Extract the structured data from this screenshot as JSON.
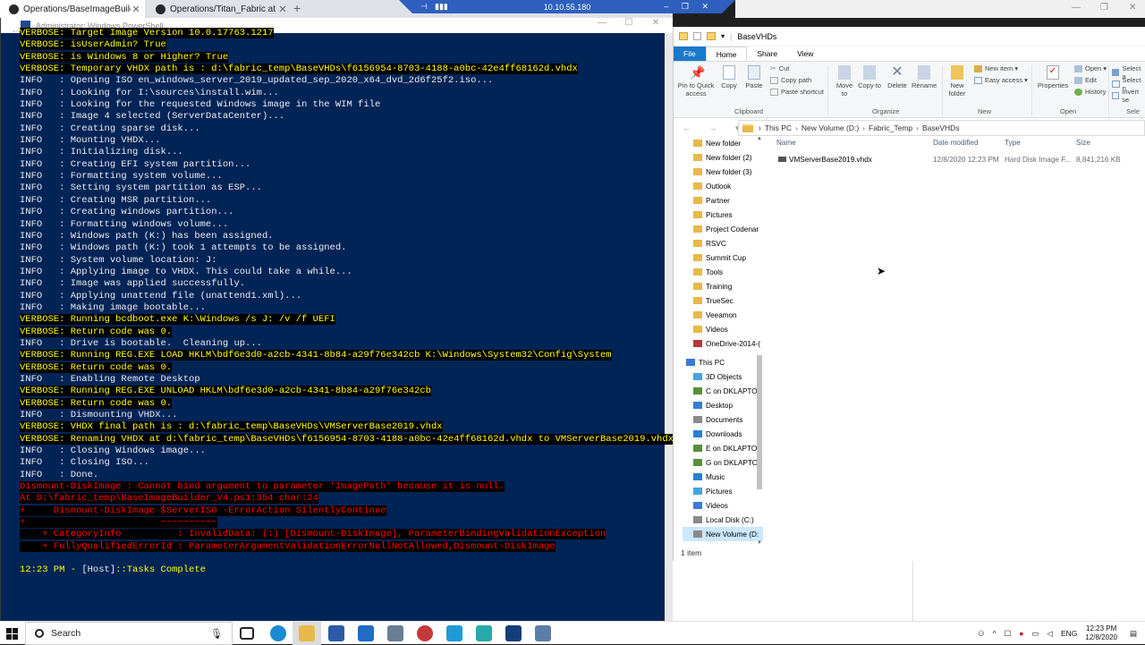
{
  "browser": {
    "tabs": [
      {
        "label": "Operations/BaseImageBuilder_V"
      },
      {
        "label": "Operations/Titan_Fabric at mast"
      }
    ],
    "new_tab": "+"
  },
  "rdp": {
    "address": "10.10.55.180",
    "pin": "⊣",
    "signal": "▮▮▮",
    "controls": "–  ❐  ✕"
  },
  "powershell": {
    "title": "Administrator: Windows PowerShell",
    "back": "←",
    "lines": [
      {
        "type": "verbose",
        "text": "VERBOSE: Target Image Version 10.0.17763.1217"
      },
      {
        "type": "verbose",
        "text": "VERBOSE: isUserAdmin? True"
      },
      {
        "type": "verbose",
        "text": "VERBOSE: is Windows 8 or Higher? True"
      },
      {
        "type": "verbose",
        "text": "VERBOSE: Temporary VHDX path is : d:\\fabric_temp\\BaseVHDs\\f6156954-8703-4188-a0bc-42e4ff68162d.vhdx"
      },
      {
        "type": "info",
        "text": "INFO   : Opening ISO en_windows_server_2019_updated_sep_2020_x64_dvd_2d6f25f2.iso..."
      },
      {
        "type": "info",
        "text": "INFO   : Looking for I:\\sources\\install.wim..."
      },
      {
        "type": "info",
        "text": "INFO   : Looking for the requested Windows image in the WIM file"
      },
      {
        "type": "info",
        "text": "INFO   : Image 4 selected (ServerDataCenter)..."
      },
      {
        "type": "info",
        "text": "INFO   : Creating sparse disk..."
      },
      {
        "type": "info",
        "text": "INFO   : Mounting VHDX..."
      },
      {
        "type": "info",
        "text": "INFO   : Initializing disk..."
      },
      {
        "type": "info",
        "text": "INFO   : Creating EFI system partition..."
      },
      {
        "type": "info",
        "text": "INFO   : Formatting system volume..."
      },
      {
        "type": "info",
        "text": "INFO   : Setting system partition as ESP..."
      },
      {
        "type": "info",
        "text": "INFO   : Creating MSR partition..."
      },
      {
        "type": "info",
        "text": "INFO   : Creating windows partition..."
      },
      {
        "type": "info",
        "text": "INFO   : Formatting windows volume..."
      },
      {
        "type": "info",
        "text": "INFO   : Windows path (K:) has been assigned."
      },
      {
        "type": "info",
        "text": "INFO   : Windows path (K:) took 1 attempts to be assigned."
      },
      {
        "type": "info",
        "text": "INFO   : System volume location: J:"
      },
      {
        "type": "info",
        "text": "INFO   : Applying image to VHDX. This could take a while..."
      },
      {
        "type": "info",
        "text": "INFO   : Image was applied successfully."
      },
      {
        "type": "info",
        "text": "INFO   : Applying unattend file (unattend1.xml)..."
      },
      {
        "type": "info",
        "text": "INFO   : Making image bootable..."
      },
      {
        "type": "verbose",
        "text": "VERBOSE: Running bcdboot.exe K:\\Windows /s J: /v /f UEFI"
      },
      {
        "type": "verbose",
        "text": "VERBOSE: Return code was 0."
      },
      {
        "type": "info",
        "text": "INFO   : Drive is bootable.  Cleaning up..."
      },
      {
        "type": "verbose",
        "text": "VERBOSE: Running REG.EXE LOAD HKLM\\bdf6e3d0-a2cb-4341-8b84-a29f76e342cb K:\\Windows\\System32\\Config\\System"
      },
      {
        "type": "verbose",
        "text": "VERBOSE: Return code was 0."
      },
      {
        "type": "info",
        "text": "INFO   : Enabling Remote Desktop"
      },
      {
        "type": "verbose",
        "text": "VERBOSE: Running REG.EXE UNLOAD HKLM\\bdf6e3d0-a2cb-4341-8b84-a29f76e342cb"
      },
      {
        "type": "verbose",
        "text": "VERBOSE: Return code was 0."
      },
      {
        "type": "info",
        "text": "INFO   : Dismounting VHDX..."
      },
      {
        "type": "verbose",
        "text": "VERBOSE: VHDX final path is : d:\\fabric_temp\\BaseVHDs\\VMServerBase2019.vhdx"
      },
      {
        "type": "verbose",
        "text": "VERBOSE: Renaming VHDX at d:\\fabric_temp\\BaseVHDs\\f6156954-8703-4188-a0bc-42e4ff68162d.vhdx to VMServerBase2019.vhdx"
      },
      {
        "type": "info",
        "text": "INFO   : Closing Windows image..."
      },
      {
        "type": "info",
        "text": "INFO   : Closing ISO..."
      },
      {
        "type": "info",
        "text": "INFO   : Done."
      },
      {
        "type": "err",
        "text": "Dismount-DiskImage : Cannot bind argument to parameter 'ImagePath' because it is null."
      },
      {
        "type": "err",
        "text": "At D:\\fabric_temp\\BaseImageBuilder_V4.ps1:354 char:24"
      },
      {
        "type": "err",
        "text": "+     Dismount-DiskImage $ServerISO -ErrorAction SilentlyContinue"
      },
      {
        "type": "err",
        "text": "+                        ~~~~~~~~~~"
      },
      {
        "type": "err",
        "text": "    + CategoryInfo          : InvalidData: (:) [Dismount-DiskImage], ParameterBindingValidationException"
      },
      {
        "type": "err",
        "text": "    + FullyQualifiedErrorId : ParameterArgumentValidationErrorNullNotAllowed,Dismount-DiskImage"
      },
      {
        "type": "blank",
        "text": ""
      }
    ],
    "prompt": {
      "time": "12:23 PM - ",
      "host": "[Host]",
      "rest": "::Tasks Complete"
    }
  },
  "explorer": {
    "title": "BaseVHDs",
    "tabs": [
      "File",
      "Home",
      "Share",
      "View"
    ],
    "ribbon": {
      "pin_label": "Pin to Quick access",
      "copy": "Copy",
      "paste": "Paste",
      "cut": "Cut",
      "copy_path": "Copy path",
      "paste_shortcut": "Paste shortcut",
      "clipboard": "Clipboard",
      "move_to": "Move to",
      "copy_to": "Copy to",
      "delete": "Delete",
      "rename": "Rename",
      "organize": "Organize",
      "new_folder": "New folder",
      "new_item": "New item ▾",
      "easy_access": "Easy access ▾",
      "new_group": "New",
      "properties": "Properties",
      "open": "Open ▾",
      "edit": "Edit",
      "history": "History",
      "open_group": "Open",
      "select_all": "Select a",
      "select_none": "Select n",
      "invert": "Invert se",
      "select_group": "Sele"
    },
    "nav_buttons": "← → ▾ ↑",
    "breadcrumb": [
      "This PC",
      "New Volume (D:)",
      "Fabric_Temp",
      "BaseVHDs"
    ],
    "nav_items": [
      {
        "label": "New folder",
        "color": "#e8b84a"
      },
      {
        "label": "New folder (2)",
        "color": "#e8b84a"
      },
      {
        "label": "New folder (3)",
        "color": "#e8b84a"
      },
      {
        "label": "Outlook",
        "color": "#e8b84a"
      },
      {
        "label": "Partner",
        "color": "#e8b84a"
      },
      {
        "label": "Pictures",
        "color": "#e8b84a"
      },
      {
        "label": "Project Codenar",
        "color": "#e8b84a"
      },
      {
        "label": "RSVC",
        "color": "#e8b84a"
      },
      {
        "label": "Summit Cup",
        "color": "#e8b84a"
      },
      {
        "label": "Tools",
        "color": "#e8b84a"
      },
      {
        "label": "Training",
        "color": "#e8b84a"
      },
      {
        "label": "TrueSec",
        "color": "#e8b84a"
      },
      {
        "label": "Veeamon",
        "color": "#e8b84a"
      },
      {
        "label": "Videos",
        "color": "#e8b84a"
      },
      {
        "label": "OneDrive-2014-(",
        "color": "#b33a3a"
      }
    ],
    "this_pc_items": [
      {
        "label": "This PC",
        "color": "#3b7bd4"
      },
      {
        "label": "3D Objects",
        "color": "#4aa3df"
      },
      {
        "label": "C on DKLAPTOP",
        "color": "#5a8f3c"
      },
      {
        "label": "Desktop",
        "color": "#3b7bd4"
      },
      {
        "label": "Documents",
        "color": "#8a8a8a"
      },
      {
        "label": "Downloads",
        "color": "#2b7fd0"
      },
      {
        "label": "E on DKLAPTOP",
        "color": "#5a8f3c"
      },
      {
        "label": "G on DKLAPTOP",
        "color": "#5a8f3c"
      },
      {
        "label": "Music",
        "color": "#2b7fd0"
      },
      {
        "label": "Pictures",
        "color": "#4aa3df"
      },
      {
        "label": "Videos",
        "color": "#3b7bd4"
      },
      {
        "label": "Local Disk (C:)",
        "color": "#8a8a8a"
      },
      {
        "label": "New Volume (D:",
        "color": "#8a8a8a"
      }
    ],
    "columns": {
      "name": "Name",
      "date": "Date modified",
      "type": "Type",
      "size": "Size"
    },
    "files": [
      {
        "name": "VMServerBase2019.vhdx",
        "date": "12/8/2020 12:23 PM",
        "type": "Hard Disk Image F...",
        "size": "8,841,216 KB"
      }
    ],
    "status": "1 item"
  },
  "taskbar": {
    "search_placeholder": "Search",
    "tray_lang": "ENG",
    "time": "12:23 PM",
    "date": "12/8/2020"
  }
}
